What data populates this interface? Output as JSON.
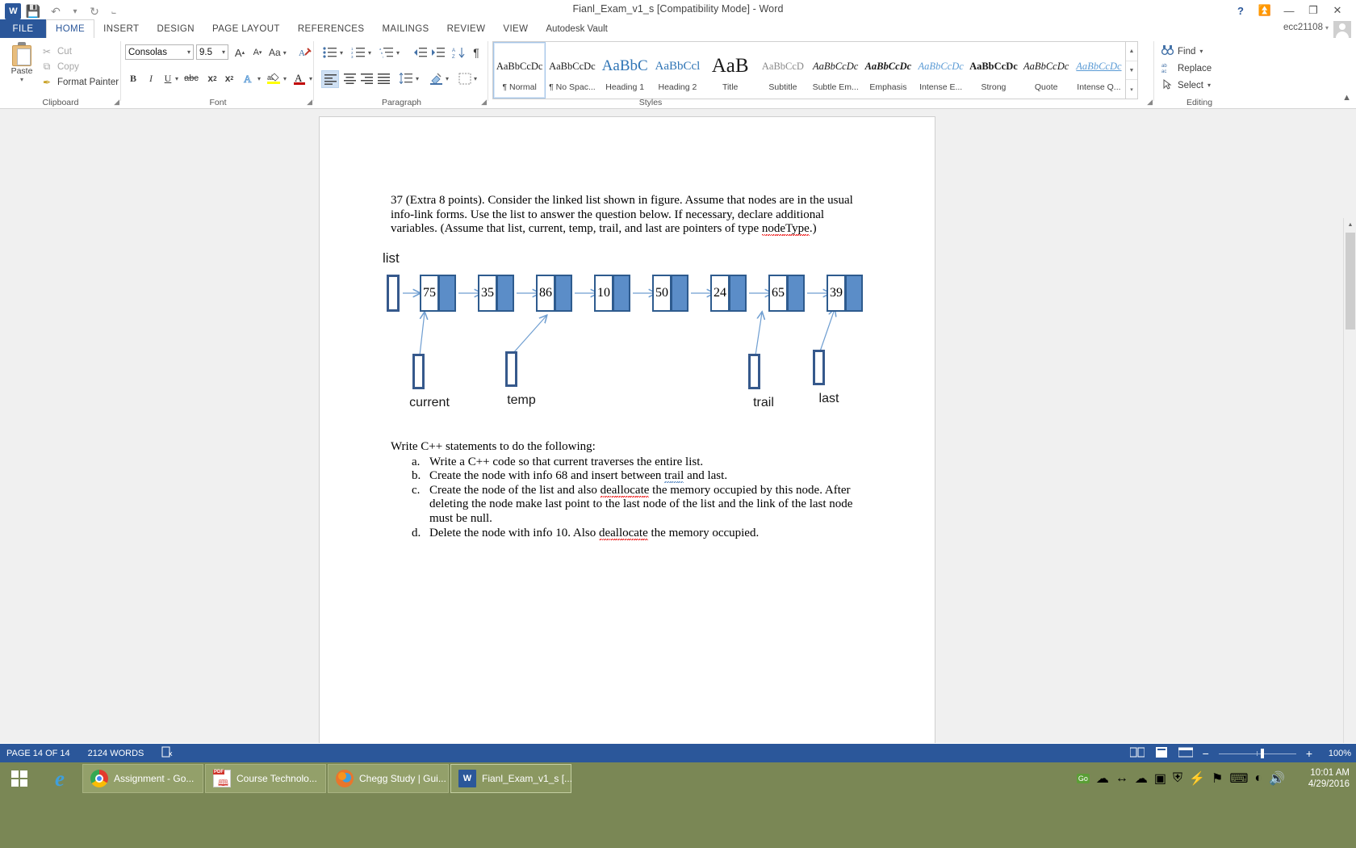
{
  "window": {
    "title": "Fianl_Exam_v1_s [Compatibility Mode] - Word",
    "account": "ecc21108",
    "help_icon": "?",
    "ribbon_display_icon": "ribbon-display-options-icon",
    "minimize_icon": "—",
    "restore_icon": "❐",
    "close_icon": "✕",
    "quick_access": [
      {
        "name": "word-logo",
        "glyph": "W"
      },
      {
        "name": "save-icon",
        "glyph": "▣"
      },
      {
        "name": "undo-icon",
        "glyph": "↶"
      },
      {
        "name": "redo-icon",
        "glyph": "↻"
      },
      {
        "name": "customize-qat-icon",
        "glyph": "⨽"
      }
    ]
  },
  "tabs": {
    "file": "FILE",
    "items": [
      {
        "label": "HOME",
        "active": true
      },
      {
        "label": "INSERT",
        "active": false
      },
      {
        "label": "DESIGN",
        "active": false
      },
      {
        "label": "PAGE LAYOUT",
        "active": false
      },
      {
        "label": "REFERENCES",
        "active": false
      },
      {
        "label": "MAILINGS",
        "active": false
      },
      {
        "label": "REVIEW",
        "active": false
      },
      {
        "label": "VIEW",
        "active": false
      },
      {
        "label": "Autodesk Vault",
        "active": false
      }
    ]
  },
  "ribbon": {
    "clipboard": {
      "group_label": "Clipboard",
      "paste_label": "Paste",
      "items": [
        {
          "label": "Cut",
          "icon": "scissors-icon",
          "glyph": "✂",
          "enabled": false
        },
        {
          "label": "Copy",
          "icon": "copy-icon",
          "glyph": "⧉",
          "enabled": false
        },
        {
          "label": "Format Painter",
          "icon": "format-painter-icon",
          "glyph": "✒",
          "enabled": true
        }
      ]
    },
    "font": {
      "group_label": "Font",
      "font_name": "Consolas",
      "font_size": "9.5",
      "grow_font": "A",
      "shrink_font": "A",
      "change_case": "Aa",
      "clear_formatting": "clear-formatting-icon",
      "bold": "B",
      "italic": "I",
      "underline": "U",
      "strikethrough": "abc",
      "subscript": "x₂",
      "superscript": "x²",
      "text_effects": "A",
      "highlight": "highlight-color-icon",
      "font_color": "font-color-icon"
    },
    "paragraph": {
      "group_label": "Paragraph",
      "bullets": "bullets-icon",
      "numbering": "numbering-icon",
      "multilevel": "multilevel-list-icon",
      "decrease_indent": "decrease-indent-icon",
      "increase_indent": "increase-indent-icon",
      "sort": "sort-icon",
      "show_marks": "¶",
      "align_left": "align-left-icon",
      "align_center": "align-center-icon",
      "align_right": "align-right-icon",
      "justify": "justify-icon",
      "line_spacing": "line-spacing-icon",
      "shading": "shading-icon",
      "borders": "borders-icon"
    },
    "styles": {
      "group_label": "Styles",
      "items": [
        {
          "preview": "AaBbCcDc",
          "name": "¶ Normal",
          "selected": true,
          "style": "normal"
        },
        {
          "preview": "AaBbCcDc",
          "name": "¶ No Spac...",
          "selected": false,
          "style": "normal"
        },
        {
          "preview": "AaBbC",
          "name": "Heading 1",
          "selected": false,
          "style": "h1"
        },
        {
          "preview": "AaBbCcl",
          "name": "Heading 2",
          "selected": false,
          "style": "h2"
        },
        {
          "preview": "AaB",
          "name": "Title",
          "selected": false,
          "style": "title"
        },
        {
          "preview": "AaBbCcD",
          "name": "Subtitle",
          "selected": false,
          "style": "subtitle"
        },
        {
          "preview": "AaBbCcDc",
          "name": "Subtle Em...",
          "selected": false,
          "style": "subtle-em"
        },
        {
          "preview": "AaBbCcDc",
          "name": "Emphasis",
          "selected": false,
          "style": "emphasis"
        },
        {
          "preview": "AaBbCcDc",
          "name": "Intense E...",
          "selected": false,
          "style": "intense-em"
        },
        {
          "preview": "AaBbCcDc",
          "name": "Strong",
          "selected": false,
          "style": "strong"
        },
        {
          "preview": "AaBbCcDc",
          "name": "Quote",
          "selected": false,
          "style": "quote"
        },
        {
          "preview": "AaBbCcDc",
          "name": "Intense Q...",
          "selected": false,
          "style": "intense-quote"
        }
      ]
    },
    "editing": {
      "group_label": "Editing",
      "find": "Find",
      "replace": "Replace",
      "select": "Select",
      "find_icon": "binoculars-icon",
      "replace_icon": "replace-icon",
      "select_icon": "pointer-icon"
    },
    "collapse_ribbon_icon": "chevron-up-icon"
  },
  "document": {
    "question_number_and_text": "37 (Extra 8 points).  Consider the linked list shown in figure. Assume that nodes are in the usual info-link forms. Use the list to answer the question below. If necessary, declare additional variables. (Assume that list, current, temp, trail, and last are pointers of type nodeType.)",
    "para1_line1": "37 (Extra 8 points).  Consider the linked list shown in figure. Assume that nodes are in the usual",
    "para1_line2": "info-link forms. Use the list to answer the question below. If necessary, declare additional",
    "para1_line3_a": "variables. (Assume that list, current, temp, trail, and last are pointers of type ",
    "para1_line3_b": "nodeType",
    "para1_line3_c": ".)",
    "prompt": "Write C++ statements to do the following:",
    "list_items": [
      {
        "marker": "a.",
        "text": "Write a C++ code so that current traverses the entire list."
      },
      {
        "marker": "b.",
        "text_a": "Create the node with info 68 and insert between ",
        "spell": "trail",
        "text_b": " and last."
      },
      {
        "marker": "c.",
        "text_a": "Create the node of the list and also ",
        "spell": "deallocate",
        "text_b": " the memory occupied by this node. After deleting the node make last point to the last node of the list and the link of the last node must be null."
      },
      {
        "marker": "d.",
        "text_a": "Delete the node with info 10. Also ",
        "spell": "deallocate",
        "text_b": " the memory occupied."
      }
    ],
    "diagram": {
      "head_label": "list",
      "nodes": [
        75,
        35,
        86,
        10,
        50,
        24,
        65,
        39
      ],
      "pointers": [
        {
          "label": "current",
          "target_node_index": 0
        },
        {
          "label": "temp",
          "target_node_index": 2
        },
        {
          "label": "trail",
          "target_node_index": 6
        },
        {
          "label": "last",
          "target_node_index": 7
        }
      ],
      "node_fill": "#ffffff",
      "link_fill": "#5b8dc8",
      "border_color": "#2e5b8e",
      "arrow_color": "#6f9ed1"
    }
  },
  "statusbar": {
    "page": "PAGE 14 OF 14",
    "words": "2124 WORDS",
    "proofing_icon": "proofing-errors-icon",
    "read_mode_icon": "read-mode-icon",
    "print_layout_icon": "print-layout-icon",
    "web_layout_icon": "web-layout-icon",
    "zoom_out": "−",
    "zoom_in": "+",
    "zoom_level": "100%"
  },
  "taskbar": {
    "start_icon": "windows-start-icon",
    "ie_icon": "internet-explorer-icon",
    "items": [
      {
        "label": "Assignment - Go...",
        "icon": "chrome-icon",
        "active": false
      },
      {
        "label": "Course Technolo...",
        "icon": "pdf-icon",
        "active": false
      },
      {
        "label": "Chegg Study | Gui...",
        "icon": "firefox-icon",
        "active": false
      },
      {
        "label": "Fianl_Exam_v1_s [...",
        "icon": "word-icon",
        "active": true
      }
    ],
    "tray": [
      {
        "name": "go-badge-icon",
        "glyph": "Go"
      },
      {
        "name": "cloud-icon",
        "glyph": "☁"
      },
      {
        "name": "network-monitor-icon",
        "glyph": "↔"
      },
      {
        "name": "onedrive-icon",
        "glyph": "☁"
      },
      {
        "name": "autodesk-icon",
        "glyph": "▣"
      },
      {
        "name": "shield-icon",
        "glyph": "⛨"
      },
      {
        "name": "usb-icon",
        "glyph": "⚡"
      },
      {
        "name": "flag-icon",
        "glyph": "⚑"
      },
      {
        "name": "keyboard-icon",
        "glyph": "⌨"
      },
      {
        "name": "network-icon",
        "glyph": "◰"
      },
      {
        "name": "volume-icon",
        "glyph": "ὐA"
      }
    ],
    "time": "10:01 AM",
    "date": "4/29/2016"
  }
}
